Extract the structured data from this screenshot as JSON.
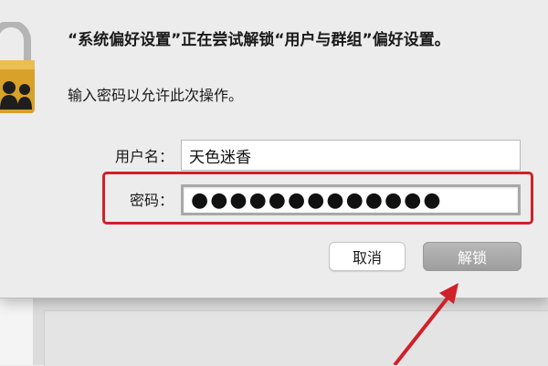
{
  "dialog": {
    "title": "“系统偏好设置”正在尝试解锁“用户与群组”偏好设置。",
    "subtitle": "输入密码以允许此次操作。",
    "username_label": "用户名：",
    "username_value": "天色迷香",
    "password_label": "密码：",
    "password_value": "●●●●●●●●●●●●●",
    "cancel_label": "取消",
    "unlock_label": "解锁"
  },
  "colors": {
    "highlight": "#d0202a",
    "arrow": "#d0202a",
    "unlock_button": "#a8a8a8"
  },
  "icons": [
    "lock-icon",
    "users-icon",
    "annotation-arrow"
  ]
}
